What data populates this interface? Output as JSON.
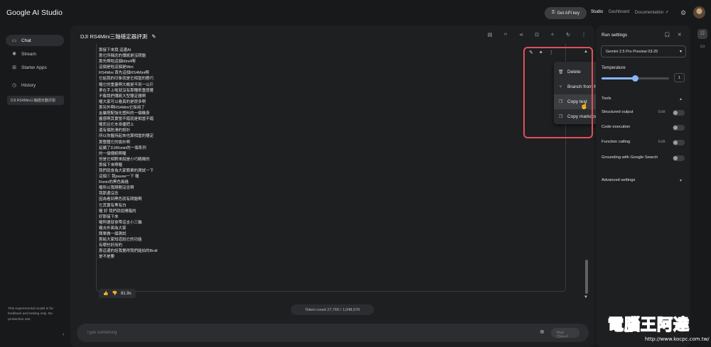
{
  "app": {
    "title": "Google AI Studio"
  },
  "header": {
    "api_key_label": "Get API key",
    "links": [
      "Studio",
      "Dashboard",
      "Documentation"
    ]
  },
  "sidebar": {
    "items": [
      {
        "label": "Chat",
        "icon": "chat-icon"
      },
      {
        "label": "Stream",
        "icon": "stream-icon"
      },
      {
        "label": "Starter Apps",
        "icon": "apps-icon"
      },
      {
        "label": "History",
        "icon": "history-icon"
      }
    ],
    "recent_item": "DJI RS4Mini三軸穩定器評測",
    "note": "This experimental model is for feedback and testing only. No production use."
  },
  "chat": {
    "title": "DJI RS4Mini三軸穩定器評測",
    "lines": [
      "那接下來我 這邊AI",
      "那它所稱念的傳統是沒問題",
      "那先啊啦這個Mini4啊",
      "這個是啦這個是Mini",
      "RS4Mini 首先這個RS4Mini啊",
      "它給我的印象就是它相當的輕巧",
      "喔它的重量啊大概是不到一公斤",
      "拿在手上啦就沒有那種笨重感覺",
      "不像我們傳統大型穩定器啊",
      "喔大家可以看真的是很多啊",
      "那另外啊RS4Mini它採用了",
      "金屬搭配強化塑料的一個機身",
      "握感啊其實蠻不錯就是相當不錯",
      "喔而且它本身握把上",
      "還有個防滑的設計",
      "所以你握持起來也算相當的穩定",
      "那整體它的設計啊",
      "延續了DJIRonin的一個系列",
      "的一個傳統啊喔",
      "但是它相對來說是小巧精緻的",
      "那接下來啊喔",
      "我們就會為大家簡單的測試一下",
      "這個三 我pause一下 喔",
      "Ronin的黑色風格",
      "喔所以我剛剛沒念啊",
      "我那邊沒念",
      "因為看到黑色就有問題啊",
      "它其實有黑有白",
      "喔 好 我們就從開箱的",
      "好那接下來",
      "喔阿德就會帶這支小三軸",
      "喔去外面為大家",
      "簡單做一個測試",
      "那給大家知道說它的功能",
      "有哪些好用的",
      "那這邊的話我覺得我們能拍的Broll",
      "是不是要"
    ],
    "rating_time": "81.9s",
    "token_count": "Token count 27,760 / 1,048,576",
    "prompt_placeholder": "Type something",
    "run_label": "Run Ctrl+⏎"
  },
  "context_menu": {
    "items": [
      {
        "label": "Delete",
        "icon": "trash-icon"
      },
      {
        "label": "Branch from here",
        "icon": "branch-icon"
      },
      {
        "label": "Copy text",
        "icon": "copy-icon"
      },
      {
        "label": "Copy markdown",
        "icon": "copy-markdown-icon"
      }
    ],
    "hovered_index": 2
  },
  "run_settings": {
    "title": "Run settings",
    "model": "Gemini 2.5 Pro Preview 03-25",
    "temperature_label": "Temperature",
    "temperature_value": "1",
    "temperature_fraction": 0.5,
    "tools_label": "Tools",
    "rows": [
      {
        "label": "Structured output",
        "edit": "Edit"
      },
      {
        "label": "Code execution",
        "edit": ""
      },
      {
        "label": "Function calling",
        "edit": "Edit"
      },
      {
        "label": "Grounding with Google Search",
        "edit": ""
      }
    ],
    "advanced": "Advanced settings"
  },
  "watermark": {
    "main": "電腦王阿達",
    "url": "http://www.kocpc.com.tw/"
  },
  "colors": {
    "highlight": "#e0505b",
    "accent": "#8ab4f8",
    "background": "#18191b"
  }
}
